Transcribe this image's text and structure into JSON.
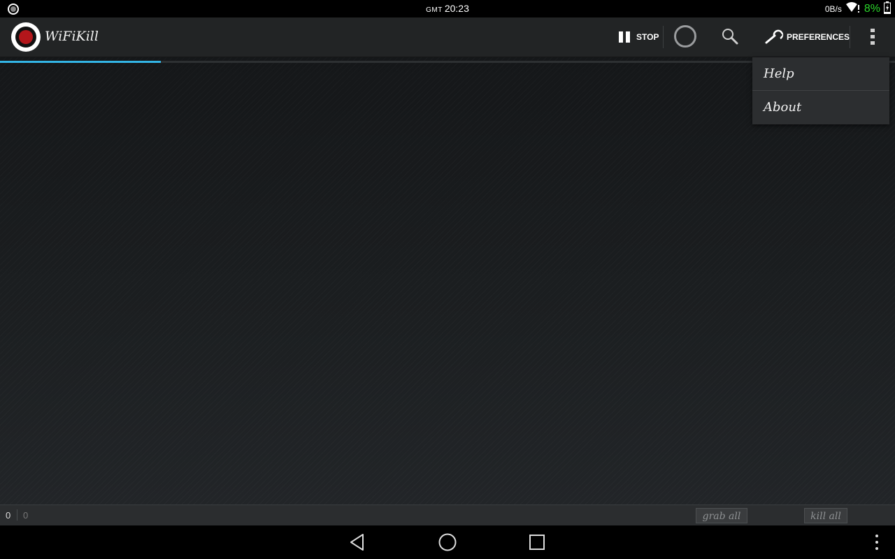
{
  "status_bar": {
    "timezone": "GMT",
    "time": "20:23",
    "net_speed": "0B/s",
    "battery_percent": "8%",
    "icons": [
      "notification-record-icon",
      "wifi-alert-icon",
      "battery-charging-icon"
    ],
    "battery_color": "#2bd62b"
  },
  "action_bar": {
    "title": "WiFiKill",
    "stop_label": "STOP",
    "preferences_label": "PREFERENCES",
    "icons": [
      "app-logo-icon",
      "pause-icon",
      "refresh-spinner-icon",
      "search-icon",
      "wrench-icon",
      "overflow-menu-icon"
    ]
  },
  "scan_progress": {
    "fraction": 0.18,
    "color": "#33b5e5"
  },
  "overflow_menu": {
    "items": [
      {
        "label": "Help"
      },
      {
        "label": "About"
      }
    ]
  },
  "footer": {
    "count_left": "0",
    "count_right": "0",
    "grab_all_label": "grab all",
    "kill_all_label": "kill all"
  },
  "nav_bar": {
    "icons": [
      "back-icon",
      "home-icon",
      "recents-icon",
      "menu-dots-icon"
    ]
  }
}
